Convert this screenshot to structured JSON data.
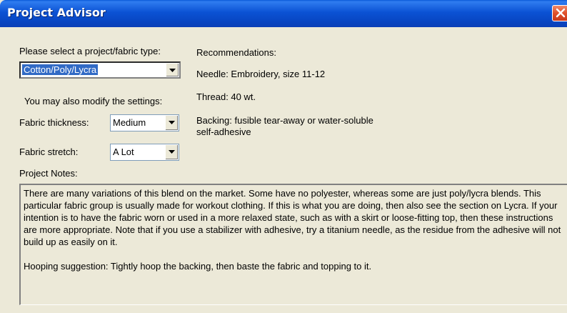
{
  "window": {
    "title": "Project Advisor"
  },
  "project_type": {
    "label": "Please select a project/fabric type:",
    "selected": "Cotton/Poly/Lycra"
  },
  "settings": {
    "intro": "You may also modify the settings:",
    "thickness": {
      "label": "Fabric thickness:",
      "selected": "Medium"
    },
    "stretch": {
      "label": "Fabric stretch:",
      "selected": "A Lot"
    }
  },
  "recommendations": {
    "heading": "Recommendations:",
    "needle": "Needle: Embroidery, size 11-12",
    "thread": "Thread: 40 wt.",
    "backing_line1": "Backing: fusible tear-away or water-soluble",
    "backing_line2": "self-adhesive"
  },
  "notes": {
    "label": "Project Notes:",
    "paragraph1": "There are many variations of this blend on the market. Some have no polyester, whereas some are just poly/lycra blends. This particular fabric group is usually made for workout clothing. If this is what you are doing, then also see the section on Lycra. If your intention is to have the fabric worn or used in a more relaxed state, such as with a skirt or loose-fitting top, then these instructions are more appropriate. Note that if you use a stabilizer with adhesive, try a titanium needle, as the residue from the adhesive will not build up as easily on it.",
    "paragraph2": "Hooping suggestion: Tightly hoop the backing, then baste the fabric and topping to it."
  },
  "icons": {
    "close": "close-icon",
    "dropdown": "chevron-down-icon"
  },
  "colors": {
    "titlebar": "#0a52d4",
    "window_bg": "#ece9d8",
    "selection": "#316ac5",
    "close_button": "#e0502a"
  }
}
